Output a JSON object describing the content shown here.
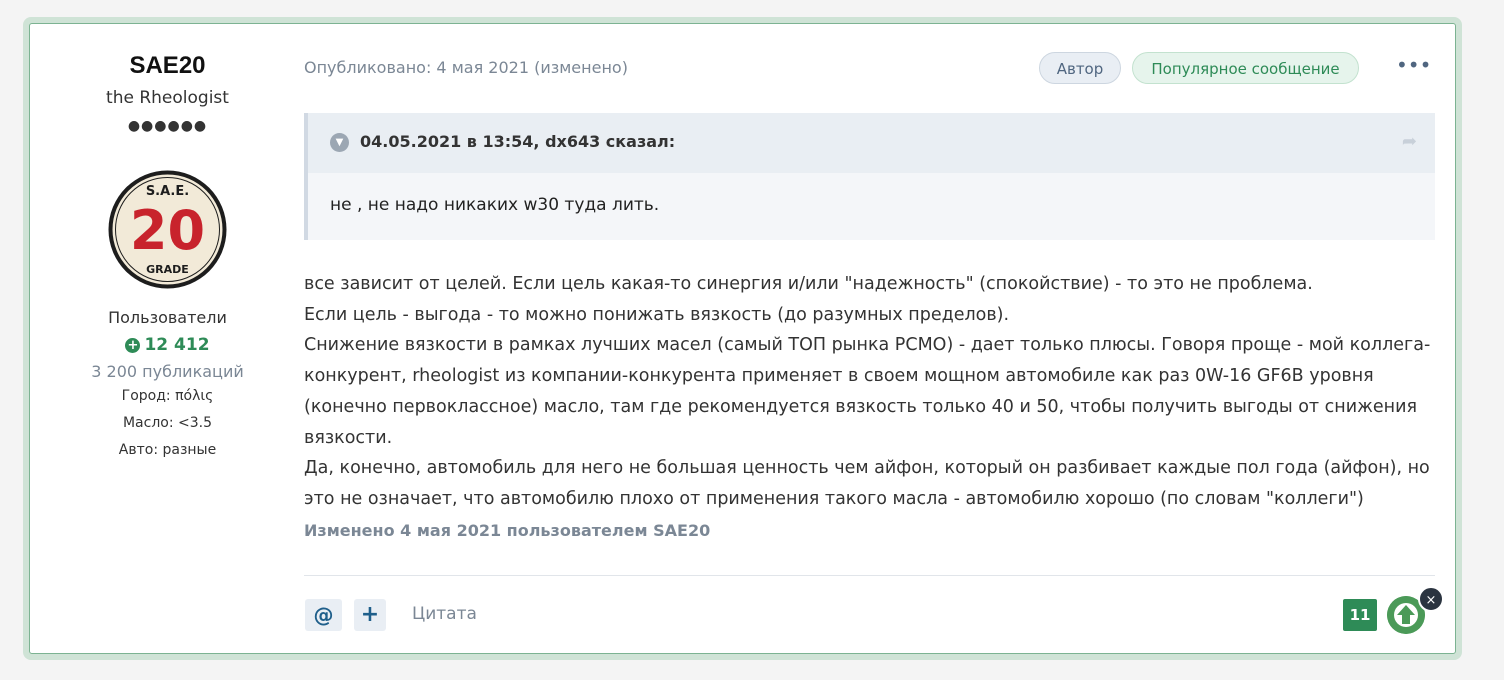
{
  "author": {
    "name": "SAE20",
    "title": "the Rheologist",
    "rank_dots": "●●●●●●",
    "avatar_text_top": "S.A.E.",
    "avatar_number": "20",
    "avatar_text_bottom": "GRADE",
    "group": "Пользователи",
    "reputation_icon": "plus-circle-icon",
    "reputation": "12 412",
    "posts_count": "3 200 публикаций",
    "fields": [
      {
        "label": "Город:",
        "value": "πόλις"
      },
      {
        "label": "Масло:",
        "value": "<3.5"
      },
      {
        "label": "Авто:",
        "value": "разные"
      }
    ]
  },
  "post": {
    "meta": "Опубликовано: 4 мая 2021 (изменено)",
    "badge_author": "Автор",
    "badge_popular": "Популярное сообщение",
    "more_icon": "•••",
    "quote": {
      "citation": "04.05.2021 в 13:54, dx643 сказал:",
      "text": "не , не надо никаких w30 туда лить."
    },
    "paragraphs": [
      "все зависит от целей. Если цель какая-то синергия и/или \"надежность\" (спокойствие) - то это не проблема.",
      "Если цель - выгода - то можно понижать вязкость (до разумных пределов).",
      "Снижение вязкости в рамках лучших масел (самый ТОП рынка PCMO) - дает только плюсы. Говоря проще - мой коллега-конкурент, rheologist из компании-конкурента применяет в своем мощном автомобиле как раз 0W-16 GF6B уровня (конечно первоклассное) масло, там где рекомендуется вязкость только 40 и 50, чтобы получить выгоды от снижения вязкости.",
      "Да, конечно, автомобиль для него не большая ценность чем айфон, который он разбивает каждые пол года (айфон), но это не означает, что автомобилю плохо от применения такого масла - автомобилю хорошо (по словам \"коллеги\")"
    ],
    "edited": "Изменено 4 мая 2021 пользователем SAE20",
    "controls": {
      "mention": "@",
      "plus": "+",
      "cite": "Цитата"
    },
    "reaction_count": "11",
    "close": "×"
  },
  "colors": {
    "accent_green": "#2e8b57",
    "muted": "#7b8795",
    "border_green": "#7cb392"
  }
}
